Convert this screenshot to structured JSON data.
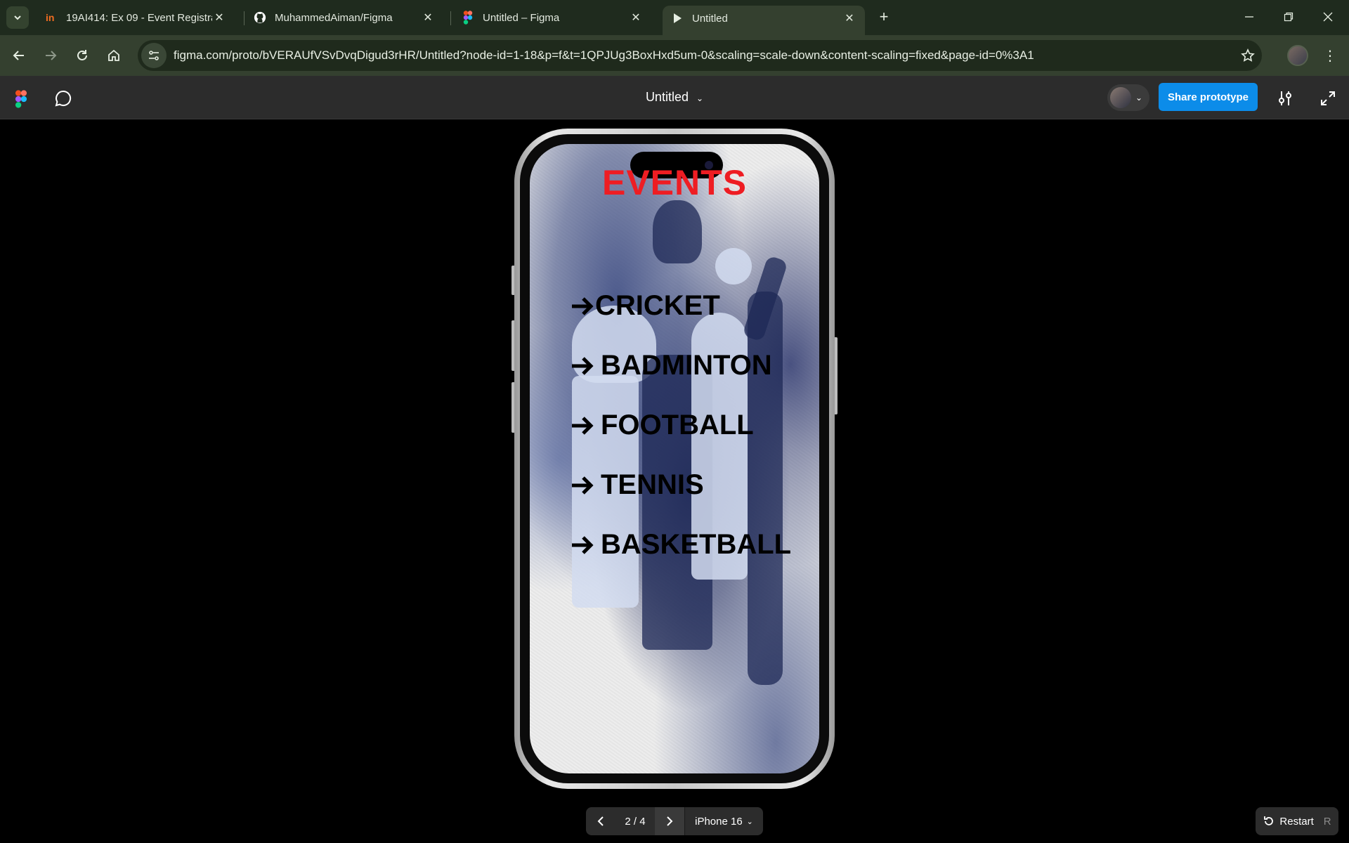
{
  "browser": {
    "tabs": [
      {
        "title": "19AI414: Ex 09 - Event Registrat",
        "icon": "invision-icon"
      },
      {
        "title": "MuhammedAiman/Figma",
        "icon": "github-icon"
      },
      {
        "title": "Untitled – Figma",
        "icon": "figma-icon"
      },
      {
        "title": "Untitled",
        "icon": "play-icon"
      }
    ],
    "url": "figma.com/proto/bVERAUfVSvDvqDigud3rHR/Untitled?node-id=1-18&p=f&t=1QPJUg3BoxHxd5um-0&scaling=scale-down&content-scaling=fixed&page-id=0%3A1"
  },
  "figma": {
    "title": "Untitled",
    "share_label": "Share prototype",
    "accent": "#0c8ce9"
  },
  "screen": {
    "heading": "EVENTS",
    "heading_color": "#ee1d23",
    "events": [
      "CRICKET",
      "BADMINTON",
      "FOOTBALL",
      "TENNIS",
      "BASKETBALL"
    ]
  },
  "footer": {
    "page": "2 / 4",
    "device": "iPhone 16",
    "restart_label": "Restart",
    "restart_key": "R"
  }
}
